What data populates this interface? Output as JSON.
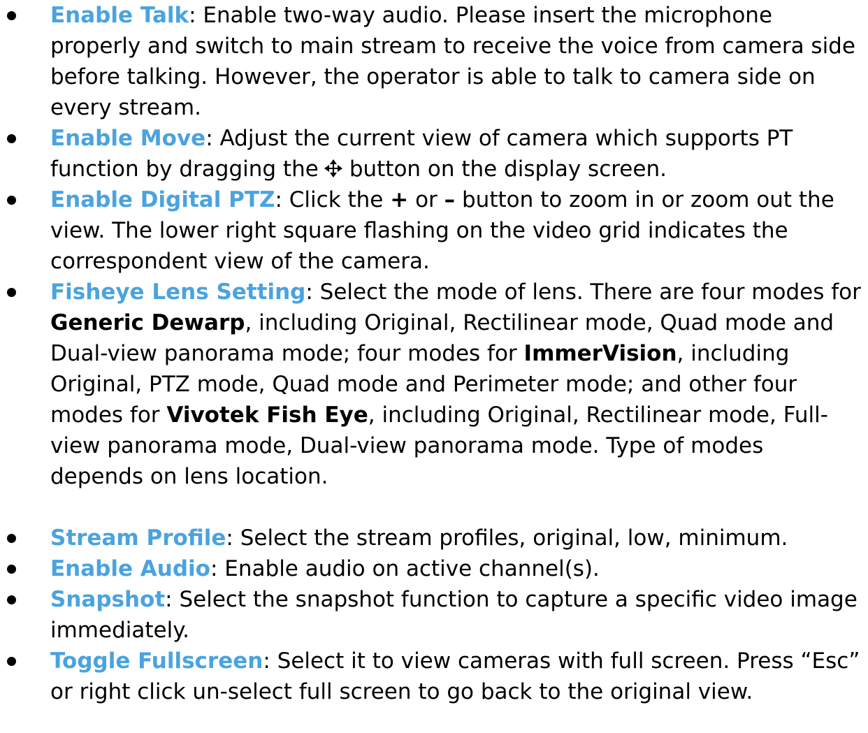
{
  "items": [
    {
      "term": "Enable Talk",
      "text": ": Enable two-way audio. Please insert the microphone properly and switch to main stream to receive the voice from camera side before talking. However, the operator is able to talk to camera side on every stream."
    },
    {
      "term": "Enable Move",
      "text_before_icon": ": Adjust the current view of camera which supports PT function by dragging the",
      "icon": "move-arrows-icon",
      "text_after_icon": "button on the display screen."
    },
    {
      "term": "Enable Digital PTZ",
      "text_a": ": Click the ",
      "plus": "+",
      "text_b": " or ",
      "minus": "–",
      "text_c": " button to zoom in or zoom out the view. The lower right square flashing on the video grid indicates the correspondent view of the camera."
    },
    {
      "term": "Fisheye Lens Setting",
      "text_a": ": Select the mode of lens. There are four modes for ",
      "generic_dewarp": "Generic Dewarp",
      "text_b": ", including Original, Rectilinear mode, Quad mode and Dual-view panorama mode; four modes for ",
      "immervision": "ImmerVision",
      "text_c": ", including Original, PTZ mode, Quad mode and Perimeter mode; and other four modes for ",
      "vivotek": "Vivotek Fish Eye",
      "text_d": ", including Original, Rectilinear mode, Full-view panorama mode, Dual-view panorama mode. Type of modes depends on lens location."
    },
    {
      "term": "Stream Profile",
      "text": ": Select the stream profiles, original, low, minimum."
    },
    {
      "term": "Enable Audio",
      "text": ": Enable audio on active channel(s)."
    },
    {
      "term": "Snapshot",
      "text": ": Select the snapshot function to capture a specific video image immediately."
    },
    {
      "term": "Toggle Fullscreen",
      "text": ": Select it to view cameras with full screen. Press “Esc” or right click un-select full screen to go back to the original view."
    }
  ],
  "colors": {
    "term": "#4aa3df",
    "text": "#000000",
    "bullet": "#000000"
  }
}
